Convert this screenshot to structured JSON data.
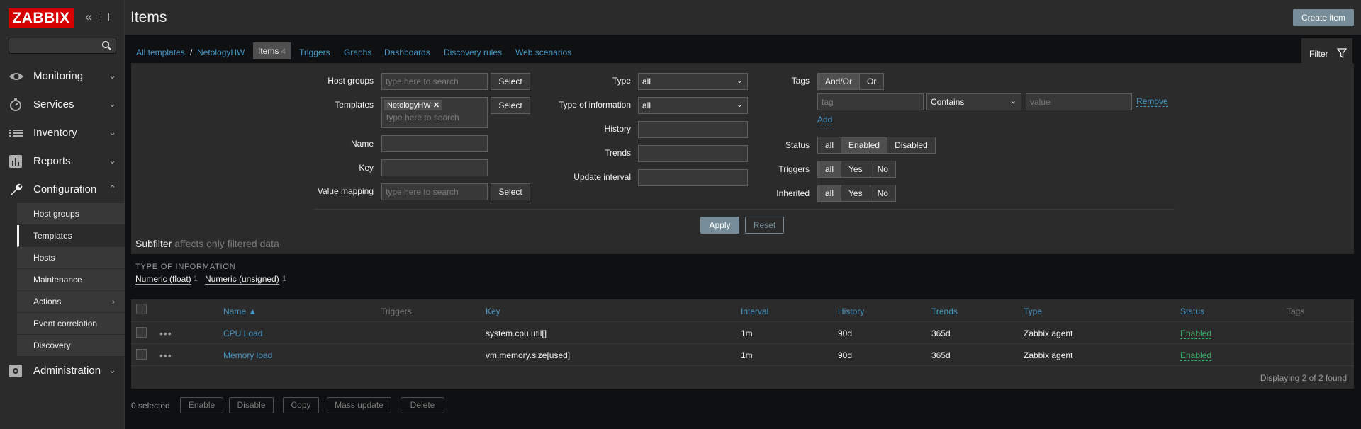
{
  "sidebar": {
    "logo": "ZABBIX",
    "menu": [
      {
        "label": "Monitoring",
        "icon": "eye-icon"
      },
      {
        "label": "Services",
        "icon": "stopwatch-icon"
      },
      {
        "label": "Inventory",
        "icon": "list-icon"
      },
      {
        "label": "Reports",
        "icon": "bar-chart-icon"
      },
      {
        "label": "Configuration",
        "icon": "wrench-icon"
      },
      {
        "label": "Administration",
        "icon": "gear-icon"
      }
    ],
    "config_items": [
      "Host groups",
      "Templates",
      "Hosts",
      "Maintenance",
      "Actions",
      "Event correlation",
      "Discovery"
    ],
    "selected_item": "Templates"
  },
  "header": {
    "title": "Items",
    "create_label": "Create item"
  },
  "nav": {
    "crumb_all": "All templates",
    "crumb_sep": "/",
    "crumb_host": "NetologyHW",
    "items_label": "Items",
    "items_count": "4",
    "tabs": [
      "Triggers",
      "Graphs",
      "Dashboards",
      "Discovery rules",
      "Web scenarios"
    ],
    "filter_label": "Filter"
  },
  "filter": {
    "host_groups_label": "Host groups",
    "templates_label": "Templates",
    "name_label": "Name",
    "key_label": "Key",
    "value_mapping_label": "Value mapping",
    "search_placeholder": "type here to search",
    "select_label": "Select",
    "template_chip": "NetologyHW",
    "type_label": "Type",
    "type_value": "all",
    "type_info_label": "Type of information",
    "type_info_value": "all",
    "history_label": "History",
    "trends_label": "Trends",
    "update_interval_label": "Update interval",
    "tags_label": "Tags",
    "tags_andor": "And/Or",
    "tags_or": "Or",
    "tag_placeholder": "tag",
    "tag_operator": "Contains",
    "value_placeholder": "value",
    "remove_label": "Remove",
    "add_label": "Add",
    "status_label": "Status",
    "status_options": [
      "all",
      "Enabled",
      "Disabled"
    ],
    "triggers_label": "Triggers",
    "inherited_label": "Inherited",
    "yes_no_options": [
      "all",
      "Yes",
      "No"
    ],
    "apply_label": "Apply",
    "reset_label": "Reset"
  },
  "subfilter": {
    "title": "Subfilter",
    "hint": "affects only filtered data",
    "category": "TYPE OF INFORMATION",
    "options": [
      {
        "label": "Numeric (float)",
        "count": "1"
      },
      {
        "label": "Numeric (unsigned)",
        "count": "1"
      }
    ]
  },
  "table": {
    "headers": {
      "name": "Name ▲",
      "triggers": "Triggers",
      "key": "Key",
      "interval": "Interval",
      "history": "History",
      "trends": "Trends",
      "type": "Type",
      "status": "Status",
      "tags": "Tags"
    },
    "rows": [
      {
        "name": "CPU Load",
        "key": "system.cpu.util[]",
        "interval": "1m",
        "history": "90d",
        "trends": "365d",
        "type": "Zabbix agent",
        "status": "Enabled"
      },
      {
        "name": "Memory load",
        "key": "vm.memory.size[used]",
        "interval": "1m",
        "history": "90d",
        "trends": "365d",
        "type": "Zabbix agent",
        "status": "Enabled"
      }
    ],
    "displaying": "Displaying 2 of 2 found"
  },
  "footer": {
    "selected": "0 selected",
    "buttons": [
      "Enable",
      "Disable",
      "Copy",
      "Mass update",
      "Delete"
    ]
  },
  "colors": {
    "accent": "#4796c4",
    "brand": "#d40000",
    "enabled": "#34af67",
    "button": "#768d99"
  }
}
